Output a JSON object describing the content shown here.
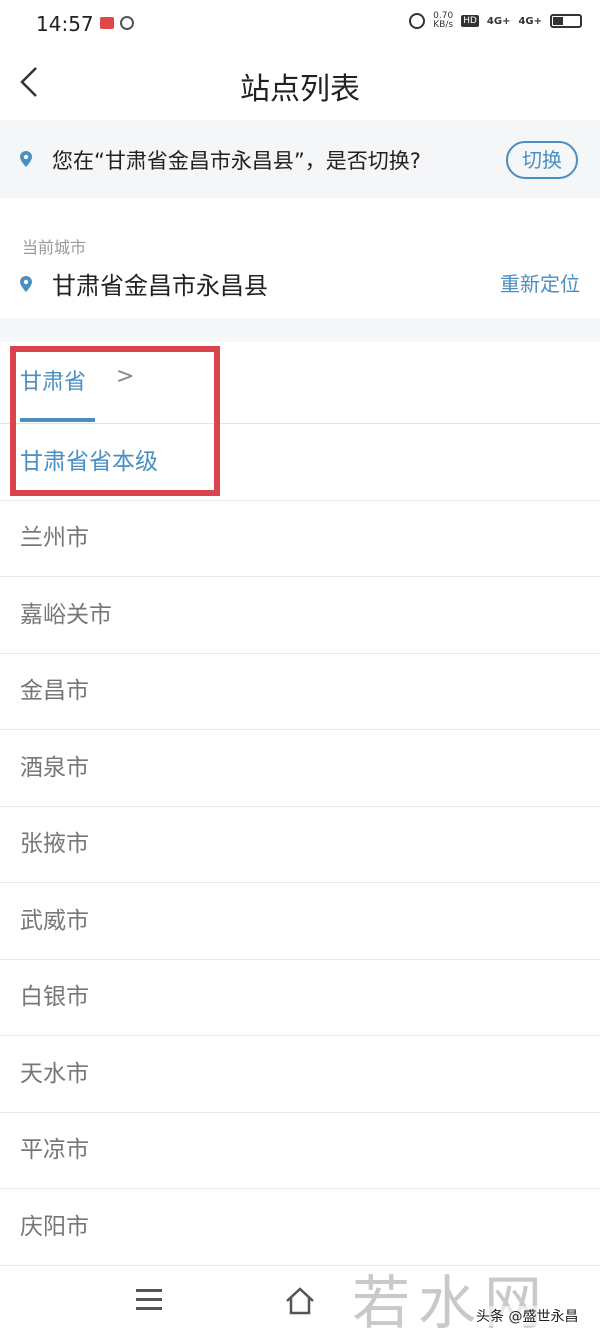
{
  "status_bar": {
    "time": "14:57",
    "speed": "0.70",
    "speed_unit": "KB/s",
    "hd": "HD",
    "network_1": "4G+",
    "network_2": "4G+"
  },
  "header": {
    "title": "站点列表"
  },
  "switch_banner": {
    "message": "您在“甘肃省金昌市永昌县”，是否切换?",
    "button_label": "切换"
  },
  "current_city": {
    "label": "当前城市",
    "value": "甘肃省金昌市永昌县",
    "relocate_label": "重新定位"
  },
  "province_tab": {
    "label": "甘肃省",
    "arrow": ">"
  },
  "city_list": [
    "甘肃省省本级",
    "兰州市",
    "嘉峪关市",
    "金昌市",
    "酒泉市",
    "张掖市",
    "武威市",
    "白银市",
    "天水市",
    "平凉市",
    "庆阳市"
  ],
  "watermark": {
    "large": "若水网",
    "small": "头条 @盛世永昌"
  },
  "colors": {
    "accent": "#4a8fc0",
    "highlight": "#d9444e"
  }
}
